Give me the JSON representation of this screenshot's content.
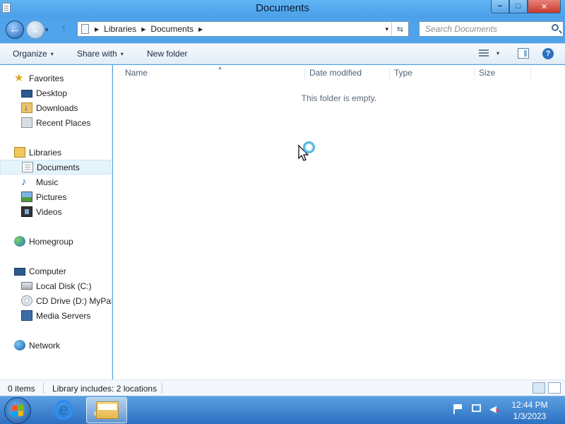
{
  "window": {
    "title": "Documents",
    "minimize": "−",
    "maximize": "□",
    "close": "✕"
  },
  "nav": {
    "back": "←",
    "forward": "→",
    "up": "↑",
    "dropdown": "▾"
  },
  "address": {
    "crumbs": [
      "Libraries",
      "Documents"
    ],
    "arrow": "▶",
    "dropdown": "▾",
    "refresh": "⇆"
  },
  "search": {
    "placeholder": "Search Documents"
  },
  "toolbar": {
    "organize": "Organize",
    "share_with": "Share with",
    "new_folder": "New folder",
    "caret": "▾",
    "help": "?"
  },
  "navpane": {
    "favorites": "Favorites",
    "desktop": "Desktop",
    "downloads": "Downloads",
    "recent_places": "Recent Places",
    "libraries": "Libraries",
    "documents": "Documents",
    "music": "Music",
    "pictures": "Pictures",
    "videos": "Videos",
    "homegroup": "Homegroup",
    "computer": "Computer",
    "local_disk": "Local Disk (C:)",
    "cd_drive": "CD Drive (D:) MyPal",
    "media_servers": "Media Servers",
    "network": "Network",
    "selected": "documents"
  },
  "content": {
    "columns": [
      "Name",
      "Date modified",
      "Type",
      "Size"
    ],
    "sort_indicator": "▲",
    "empty_message": "This folder is empty."
  },
  "status": {
    "item_count": "0 items",
    "library_info": "Library includes: 2 locations"
  },
  "taskbar": {
    "time": "12:44 PM",
    "date": "1/3/2023",
    "accent": "#2c70c2"
  }
}
